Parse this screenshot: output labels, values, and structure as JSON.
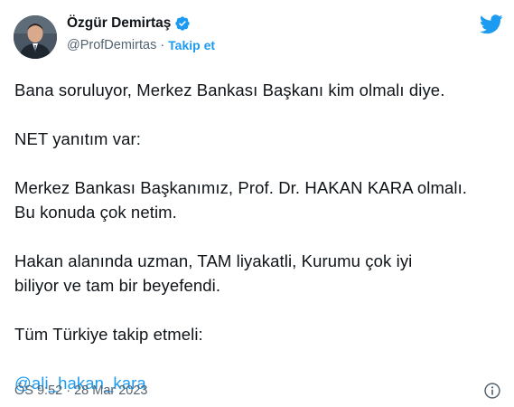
{
  "author": {
    "display_name": "Özgür Demirtaş",
    "handle": "@ProfDemirtas",
    "separator": "·",
    "follow_label": "Takip et"
  },
  "tweet": {
    "paragraphs": [
      [
        "Bana soruluyor, Merkez Bankası Başkanı kim olmalı diye."
      ],
      [
        "NET yanıtım var:"
      ],
      [
        "Merkez Bankası Başkanımız, Prof. Dr. HAKAN KARA olmalı.",
        "Bu konuda çok netim."
      ],
      [
        "Hakan alanında uzman, TAM liyakatli, Kurumu çok iyi",
        "biliyor ve tam bir beyefendi."
      ],
      [
        "Tüm Türkiye takip etmeli:"
      ]
    ],
    "mention": "@ali_hakan_kara",
    "timestamp": "ÖS 9:52 · 28 Mar 2023"
  },
  "icons": {
    "verified": "verified-badge-icon",
    "platform": "twitter-bird-icon",
    "info": "info-icon"
  },
  "colors": {
    "accent": "#1d9bf0",
    "secondary_text": "#536471",
    "primary_text": "#0f1419"
  }
}
